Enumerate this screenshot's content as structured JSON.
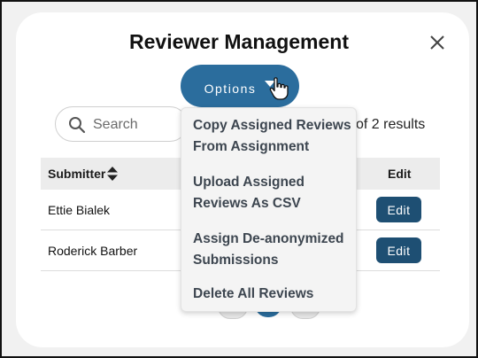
{
  "modal": {
    "title": "Reviewer Management",
    "close_label": "close"
  },
  "options": {
    "label": "Options",
    "menu": [
      {
        "label": "Copy Assigned Reviews From Assignment"
      },
      {
        "label": "Upload Assigned Reviews As CSV"
      },
      {
        "label": "Assign De-anonymized Submissions"
      },
      {
        "label": "Delete All Reviews"
      }
    ]
  },
  "search": {
    "placeholder": "Search",
    "value": ""
  },
  "results_text": "of 2 results",
  "table": {
    "columns": [
      "Submitter",
      "Edit"
    ],
    "rows": [
      {
        "submitter": "Ettie Bialek",
        "edit_label": "Edit"
      },
      {
        "submitter": "Roderick Barber",
        "edit_label": "Edit"
      }
    ]
  },
  "pagination": {
    "current_page": 1
  },
  "colors": {
    "primary": "#2b6d9d",
    "edit_button": "#1e4f73",
    "menu_background": "#f4f4f4",
    "header_background": "#ececec"
  },
  "icons": [
    "close-icon",
    "dropdown-caret-icon",
    "hand-cursor-icon",
    "search-icon",
    "sort-icon"
  ]
}
